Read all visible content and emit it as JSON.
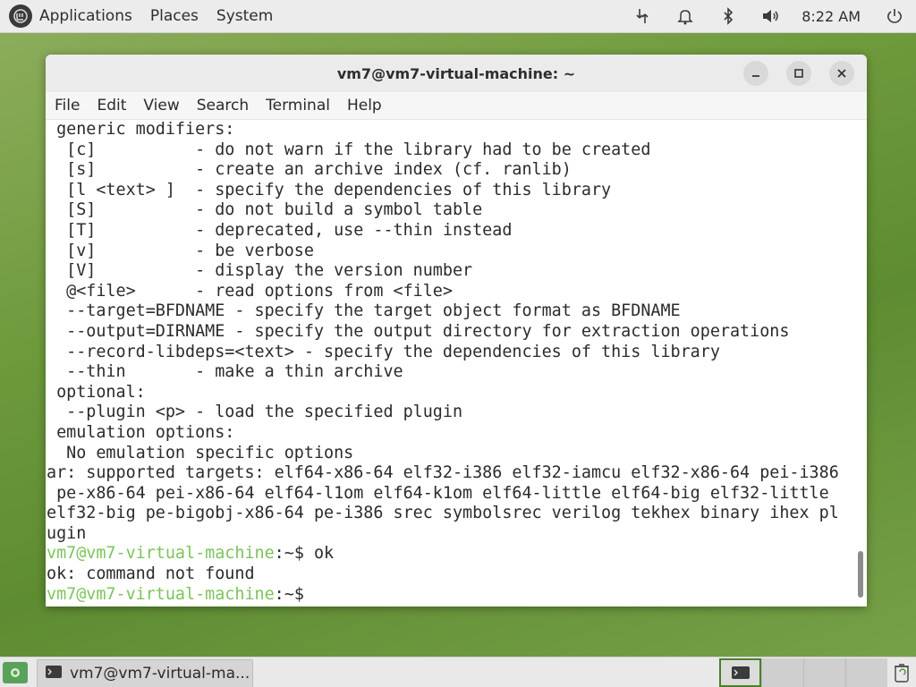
{
  "top_panel": {
    "menu_items": [
      "Applications",
      "Places",
      "System"
    ],
    "clock": "8:22 AM"
  },
  "window": {
    "title": "vm7@vm7-virtual-machine: ~",
    "menu": [
      "File",
      "Edit",
      "View",
      "Search",
      "Terminal",
      "Help"
    ]
  },
  "terminal": {
    "lines": [
      {
        "text": " generic modifiers:"
      },
      {
        "text": "  [c]          - do not warn if the library had to be created"
      },
      {
        "text": "  [s]          - create an archive index (cf. ranlib)"
      },
      {
        "text": "  [l <text> ]  - specify the dependencies of this library"
      },
      {
        "text": "  [S]          - do not build a symbol table"
      },
      {
        "text": "  [T]          - deprecated, use --thin instead"
      },
      {
        "text": "  [v]          - be verbose"
      },
      {
        "text": "  [V]          - display the version number"
      },
      {
        "text": "  @<file>      - read options from <file>"
      },
      {
        "text": "  --target=BFDNAME - specify the target object format as BFDNAME"
      },
      {
        "text": "  --output=DIRNAME - specify the output directory for extraction operations"
      },
      {
        "text": "  --record-libdeps=<text> - specify the dependencies of this library"
      },
      {
        "text": "  --thin       - make a thin archive"
      },
      {
        "text": " optional:"
      },
      {
        "text": "  --plugin <p> - load the specified plugin"
      },
      {
        "text": " emulation options:"
      },
      {
        "text": "  No emulation specific options"
      },
      {
        "text": "ar: supported targets: elf64-x86-64 elf32-i386 elf32-iamcu elf32-x86-64 pei-i386"
      },
      {
        "text": " pe-x86-64 pei-x86-64 elf64-l1om elf64-k1om elf64-little elf64-big elf32-little"
      },
      {
        "text": "elf32-big pe-bigobj-x86-64 pe-i386 srec symbolsrec verilog tekhex binary ihex pl"
      },
      {
        "text": "ugin"
      },
      {
        "prompt": "vm7@vm7-virtual-machine",
        "suffix": ":~$ ok"
      },
      {
        "text": "ok: command not found"
      },
      {
        "prompt": "vm7@vm7-virtual-machine",
        "suffix": ":~$ "
      }
    ]
  },
  "bottom_panel": {
    "task_label": "vm7@vm7-virtual-ma..."
  },
  "colors": {
    "prompt": "#7cc35a",
    "desktop": "#6e9a3c",
    "workspace_active_border": "#4b7f2c"
  },
  "icons": {
    "menu_logo": "mint-logo-icon",
    "network": "network-icon",
    "notifications": "bell-icon",
    "bluetooth": "bluetooth-icon",
    "volume": "volume-icon",
    "power": "power-icon",
    "trash": "trash-icon"
  }
}
